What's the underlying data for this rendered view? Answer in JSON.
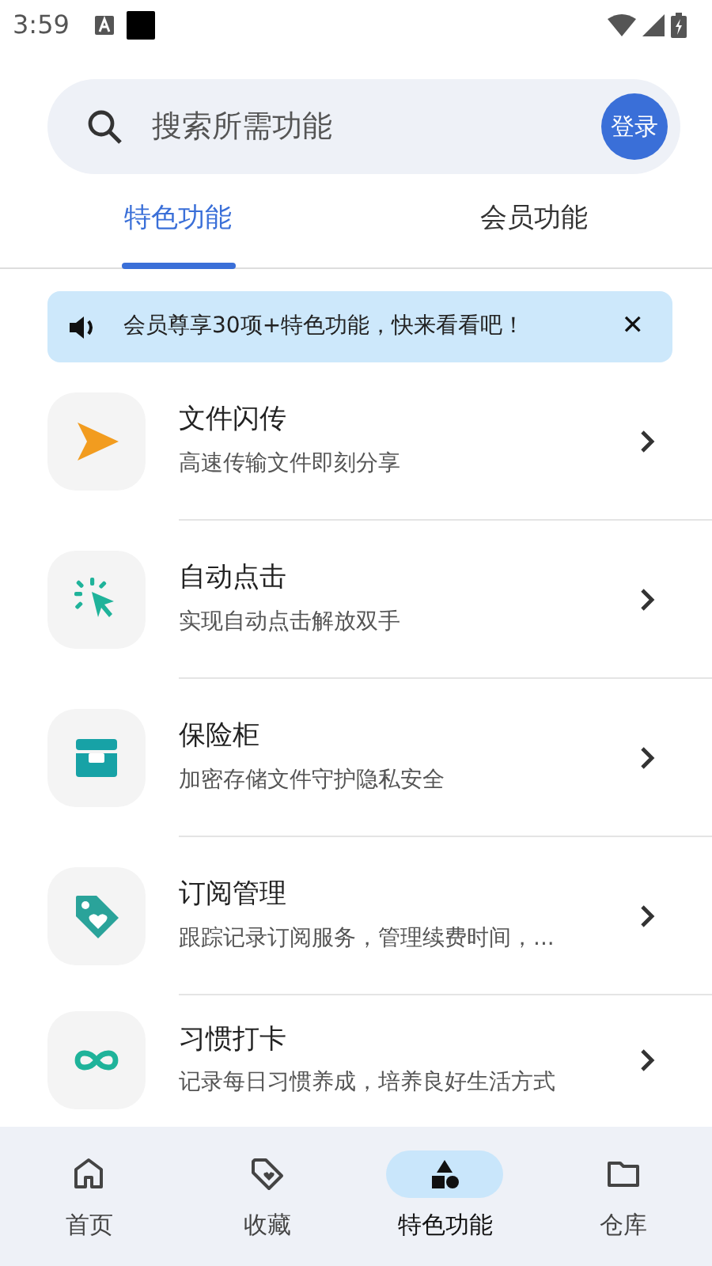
{
  "status_bar": {
    "time": "3:59"
  },
  "search": {
    "placeholder": "搜索所需功能",
    "login": "登录"
  },
  "tabs": [
    {
      "label": "特色功能",
      "selected": true
    },
    {
      "label": "会员功能",
      "selected": false
    }
  ],
  "notice": {
    "text": "会员尊享30项+特色功能，快来看看吧！",
    "close": "✕"
  },
  "items": [
    {
      "kind": "send",
      "title": "文件闪传",
      "subtitle": "高速传输文件即刻分享"
    },
    {
      "kind": "click",
      "title": "自动点击",
      "subtitle": "实现自动点击解放双手"
    },
    {
      "kind": "safe",
      "title": "保险柜",
      "subtitle": "加密存储文件守护隐私安全"
    },
    {
      "kind": "tag",
      "title": "订阅管理",
      "subtitle": "跟踪记录订阅服务，管理续费时间，..."
    },
    {
      "kind": "loop",
      "title": "习惯打卡",
      "subtitle": "记录每日习惯养成，培养良好生活方式"
    }
  ],
  "bottom_nav": [
    {
      "kind": "home",
      "label": "首页",
      "selected": false
    },
    {
      "kind": "tag",
      "label": "收藏",
      "selected": false
    },
    {
      "kind": "shapes",
      "label": "特色功能",
      "selected": true
    },
    {
      "kind": "folder",
      "label": "仓库",
      "selected": false
    }
  ]
}
